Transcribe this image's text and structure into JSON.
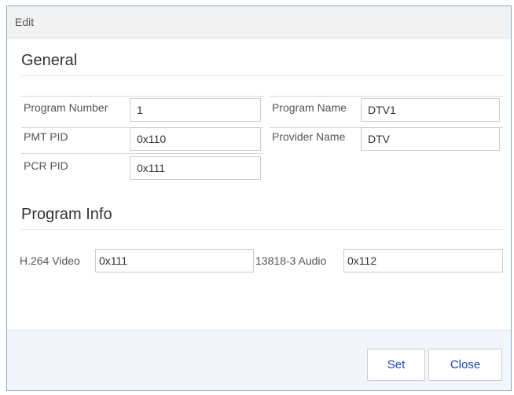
{
  "dialog": {
    "title": "Edit"
  },
  "general": {
    "heading": "General",
    "program_number": {
      "label": "Program Number",
      "value": "1"
    },
    "program_name": {
      "label": "Program Name",
      "value": "DTV1"
    },
    "pmt_pid": {
      "label": "PMT PID",
      "value": "0x110"
    },
    "provider_name": {
      "label": "Provider Name",
      "value": "DTV"
    },
    "pcr_pid": {
      "label": "PCR PID",
      "value": "0x111"
    }
  },
  "program_info": {
    "heading": "Program Info",
    "video": {
      "label": "H.264 Video",
      "value": "0x111"
    },
    "audio": {
      "label": "13818-3 Audio",
      "value": "0x112"
    }
  },
  "footer": {
    "set_label": "Set",
    "close_label": "Close"
  },
  "colors": {
    "button_text": "#1a46b8",
    "border": "#8fa8c8",
    "footer_bg": "#f2f5fb"
  }
}
